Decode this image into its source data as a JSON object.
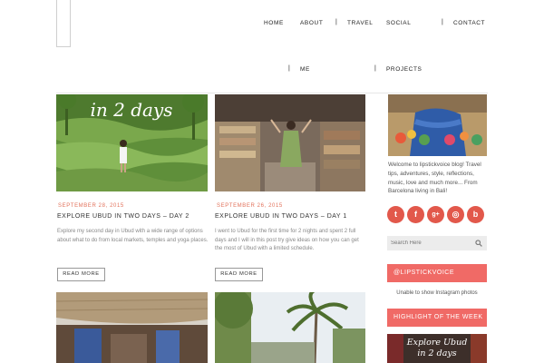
{
  "nav": {
    "home": "HOME",
    "about": "ABOUT",
    "me": "ME",
    "travel": "TRAVEL",
    "social": "SOCIAL",
    "projects": "PROJECTS",
    "contact": "CONTACT",
    "separator": "|"
  },
  "posts": [
    {
      "image_text": "in 2 days",
      "date": "SEPTEMBER 28, 2015",
      "title": "EXPLORE UBUD IN TWO DAYS – DAY 2",
      "excerpt": "Explore my second day in Ubud with a wide range of options about what to do from local markets, temples and yoga places.",
      "read_more": "READ MORE"
    },
    {
      "date": "SEPTEMBER 26, 2015",
      "title": "EXPLORE UBUD IN TWO DAYS – DAY 1",
      "excerpt": "I went to Ubud for the first time for 2 nights and spent 2 full days and I will in this post try give ideas on how you can get the most of Ubud with a limited schedule.",
      "read_more": "READ MORE"
    }
  ],
  "sidebar": {
    "welcome": "Welcome to lipstickvoice blog! Travel tips, adventures, style, reflections, music, love and much more... From Barcelona living in Bali!",
    "social": [
      "twitter-icon",
      "facebook-icon",
      "google-plus-icon",
      "instagram-icon",
      "bloglovin-icon"
    ],
    "social_glyphs": [
      "t",
      "f",
      "g+",
      "◎",
      "b"
    ],
    "search_placeholder": "Search Here",
    "instagram_title": "@LIPSTICKVOICE",
    "instagram_note": "Unable to show Instagram photos",
    "highlight_title": "HIGHLIGHT OF THE WEEK",
    "highlight_image_text_1": "Explore Ubud",
    "highlight_image_text_2": "in 2 days"
  },
  "colors": {
    "accent": "#f06a66",
    "date": "#e2725b",
    "social": "#e2584b"
  }
}
